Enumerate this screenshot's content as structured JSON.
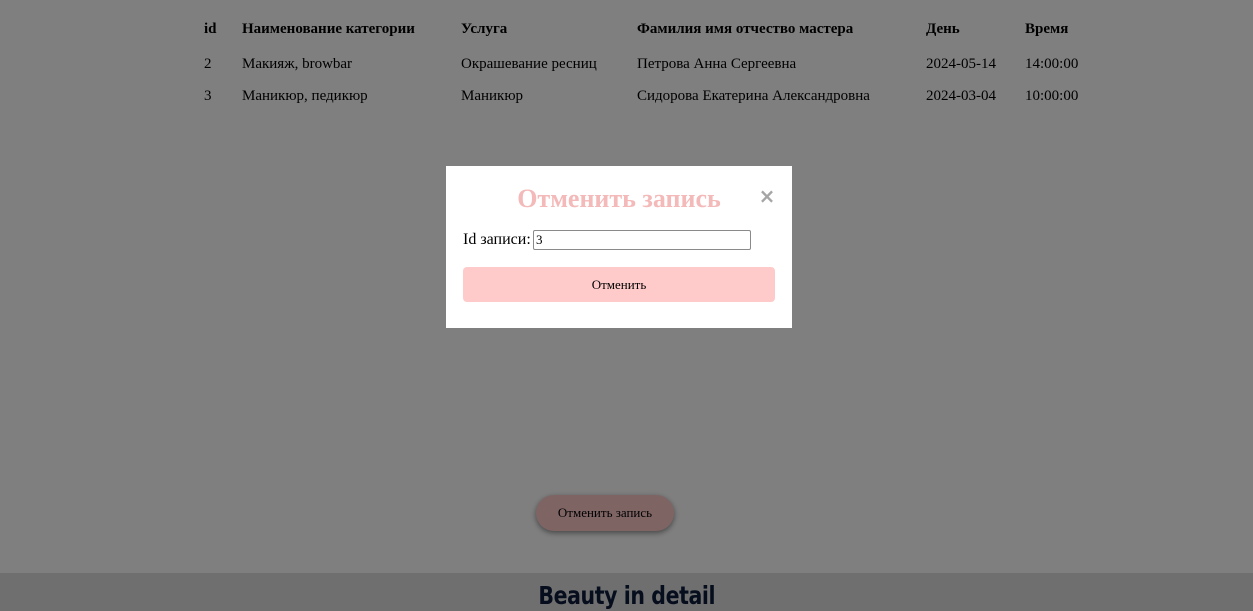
{
  "table": {
    "headers": [
      "id",
      "Наименование категории",
      "Услуга",
      "Фамилия имя отчество мастера",
      "День",
      "Время"
    ],
    "rows": [
      [
        "2",
        "Макияж, browbar",
        "Окрашевание ресниц",
        "Петрова Анна Сергеевна",
        "2024-05-14",
        "14:00:00"
      ],
      [
        "3",
        "Маникюр, педикюр",
        "Маникюр",
        "Сидорова Екатерина Александровна",
        "2024-03-04",
        "10:00:00"
      ]
    ]
  },
  "page": {
    "cancel_button_label": "Отменить запись"
  },
  "footer": {
    "brand": "Beauty in detail"
  },
  "modal": {
    "title": "Отменить запись",
    "close_glyph": "×",
    "field_label": "Id записи:",
    "field_value": "3",
    "submit_label": "Отменить"
  },
  "colors": {
    "overlay": "#000000",
    "modal_title": "#f4b9b9",
    "button_fill": "#ffc8c8",
    "footer_text": "#0d1b3a"
  }
}
